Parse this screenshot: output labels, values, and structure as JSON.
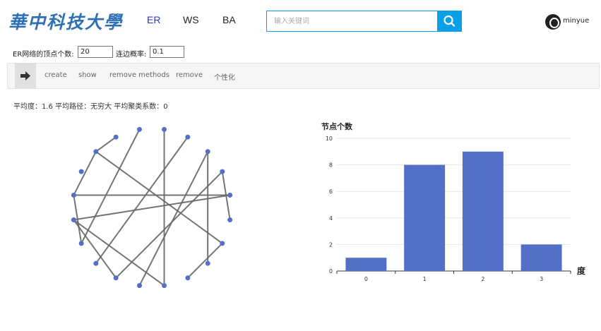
{
  "header": {
    "logo_text": "華中科技大學",
    "nav": [
      {
        "label": "ER",
        "active": true
      },
      {
        "label": "WS",
        "active": false
      },
      {
        "label": "BA",
        "active": false
      }
    ],
    "search": {
      "placeholder": "输入关键词",
      "icon": "search-icon"
    },
    "user": {
      "name": "minyue",
      "avatar_icon": "github-icon"
    }
  },
  "params": {
    "vertex_label": "ER网络的顶点个数:",
    "vertex_value": "20",
    "prob_label": "连边概率:",
    "prob_value": "0.1"
  },
  "toolbar": {
    "arrow_icon": "arrow-right-icon",
    "items": [
      "create",
      "show",
      "remove methods",
      "remove",
      "个性化"
    ]
  },
  "stats": {
    "text": "平均度：1.6 平均路径：无穷大 平均聚类系数：0"
  },
  "graph": {
    "node_color": "#5470c6",
    "edge_color": "#666666",
    "node_count": 20,
    "edges": [
      [
        1,
        10
      ],
      [
        2,
        13
      ],
      [
        3,
        8
      ],
      [
        3,
        11
      ],
      [
        4,
        12
      ],
      [
        4,
        6
      ],
      [
        5,
        15
      ],
      [
        5,
        16
      ],
      [
        7,
        9
      ],
      [
        7,
        18
      ],
      [
        10,
        15
      ],
      [
        12,
        15
      ],
      [
        14,
        16
      ],
      [
        16,
        18
      ],
      [
        18,
        19
      ],
      [
        0,
        14
      ]
    ]
  },
  "chart_data": {
    "type": "bar",
    "title": "节点个数",
    "xlabel": "度",
    "categories": [
      "0",
      "1",
      "2",
      "3"
    ],
    "values": [
      1,
      8,
      9,
      2
    ],
    "ylim": [
      0,
      10
    ],
    "yticks": [
      "0",
      "2",
      "4",
      "6",
      "8",
      "10"
    ],
    "bar_color": "#5470c6",
    "grid": true
  }
}
